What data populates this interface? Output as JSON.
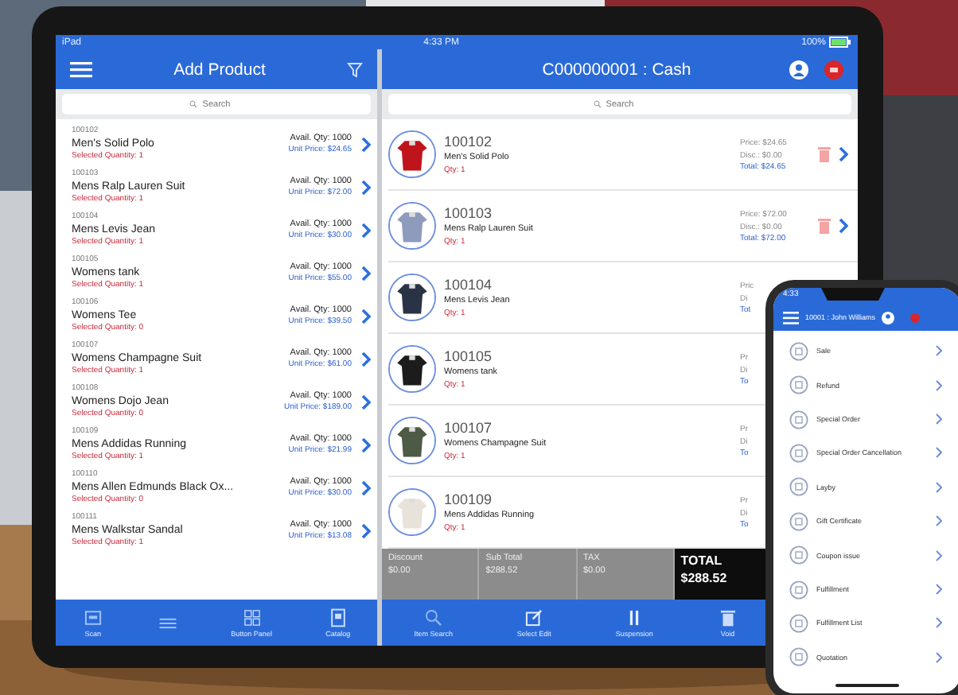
{
  "tablet": {
    "status_bar": {
      "carrier": "iPad",
      "time": "4:33 PM",
      "battery": "100%"
    },
    "left_pane": {
      "title": "Add Product",
      "search": {
        "placeholder": "Search"
      },
      "items": [
        {
          "code": "100102",
          "name": "Men's Solid Polo",
          "selected_qty": "Selected Quantity: 1",
          "avail": "Avail. Qty: 1000",
          "price": "Unit Price: $24.65"
        },
        {
          "code": "100103",
          "name": "Mens Ralp Lauren Suit",
          "selected_qty": "Selected Quantity: 1",
          "avail": "Avail. Qty: 1000",
          "price": "Unit Price: $72.00"
        },
        {
          "code": "100104",
          "name": "Mens Levis Jean",
          "selected_qty": "Selected Quantity: 1",
          "avail": "Avail. Qty: 1000",
          "price": "Unit Price: $30.00"
        },
        {
          "code": "100105",
          "name": "Womens tank",
          "selected_qty": "Selected Quantity: 1",
          "avail": "Avail. Qty: 1000",
          "price": "Unit Price: $55.00"
        },
        {
          "code": "100106",
          "name": "Womens Tee",
          "selected_qty": "Selected Quantity: 0",
          "avail": "Avail. Qty: 1000",
          "price": "Unit Price: $39.50"
        },
        {
          "code": "100107",
          "name": "Womens Champagne Suit",
          "selected_qty": "Selected Quantity: 1",
          "avail": "Avail. Qty: 1000",
          "price": "Unit Price: $61.00"
        },
        {
          "code": "100108",
          "name": "Womens Dojo Jean",
          "selected_qty": "Selected Quantity: 0",
          "avail": "Avail. Qty: 1000",
          "price": "Unit Price: $189.00"
        },
        {
          "code": "100109",
          "name": "Mens Addidas Running",
          "selected_qty": "Selected Quantity: 1",
          "avail": "Avail. Qty: 1000",
          "price": "Unit Price: $21.99"
        },
        {
          "code": "100110",
          "name": "Mens Allen Edmunds Black Ox...",
          "selected_qty": "Selected Quantity: 0",
          "avail": "Avail. Qty: 1000",
          "price": "Unit Price: $30.00"
        },
        {
          "code": "100111",
          "name": "Mens Walkstar Sandal",
          "selected_qty": "Selected Quantity: 1",
          "avail": "Avail. Qty: 1000",
          "price": "Unit Price: $13.08"
        }
      ],
      "tabs": [
        {
          "kind": "scan",
          "label": "Scan"
        },
        {
          "kind": "lines"
        },
        {
          "kind": "grid",
          "label": "Button Panel"
        },
        {
          "kind": "catalog",
          "label": "Catalog"
        }
      ]
    },
    "right_pane": {
      "title": "C000000001 : Cash",
      "search": {
        "placeholder": "Search"
      },
      "cart": [
        {
          "code": "100102",
          "name": "Men's Solid Polo",
          "qty": "Qty: 1",
          "price": "Price: $24.65",
          "disc": "Disc.: $0.00",
          "total": "Total: $24.65",
          "color": "#c0141c",
          "actions_shown": true
        },
        {
          "code": "100103",
          "name": "Mens Ralp Lauren Suit",
          "qty": "Qty: 1",
          "price": "Price: $72.00",
          "disc": "Disc.: $0.00",
          "total": "Total: $72.00",
          "color": "#8f9bbd",
          "actions_shown": true
        },
        {
          "code": "100104",
          "name": "Mens Levis Jean",
          "qty": "Qty: 1",
          "price": "Pric",
          "disc": "Di",
          "total": "Tot",
          "color": "#2a3346"
        },
        {
          "code": "100105",
          "name": "Womens tank",
          "qty": "Qty: 1",
          "price": "Pr",
          "disc": "Di",
          "total": "To",
          "color": "#1c1c1c"
        },
        {
          "code": "100107",
          "name": "Womens Champagne Suit",
          "qty": "Qty: 1",
          "price": "Pr",
          "disc": "Di",
          "total": "To",
          "color": "#4d5a45"
        },
        {
          "code": "100109",
          "name": "Mens Addidas Running",
          "qty": "Qty: 1",
          "price": "Pr",
          "disc": "Di",
          "total": "To",
          "color": "#e8e2da"
        }
      ],
      "summary": [
        {
          "label": "Discount",
          "value": "$0.00",
          "kind": "plain"
        },
        {
          "label": "Sub Total",
          "value": "$288.52",
          "kind": "plain"
        },
        {
          "label": "TAX",
          "value": "$0.00",
          "kind": "plain"
        },
        {
          "label": "TOTAL",
          "value": "$288.52",
          "kind": "total"
        }
      ],
      "tabs": [
        {
          "kind": "search",
          "label": "Item Search"
        },
        {
          "kind": "edit",
          "label": "Select Edit"
        },
        {
          "kind": "pause",
          "label": "Suspension"
        },
        {
          "kind": "trash",
          "label": "Void"
        }
      ]
    }
  },
  "phone": {
    "time": "4:33",
    "title": "10001 : John Williams",
    "menu": [
      "Sale",
      "Refund",
      "Special Order",
      "Special Order Cancellation",
      "Layby",
      "Gift Certificate",
      "Coupon issue",
      "Fulfillment",
      "Fulfillment List",
      "Quotation"
    ]
  }
}
